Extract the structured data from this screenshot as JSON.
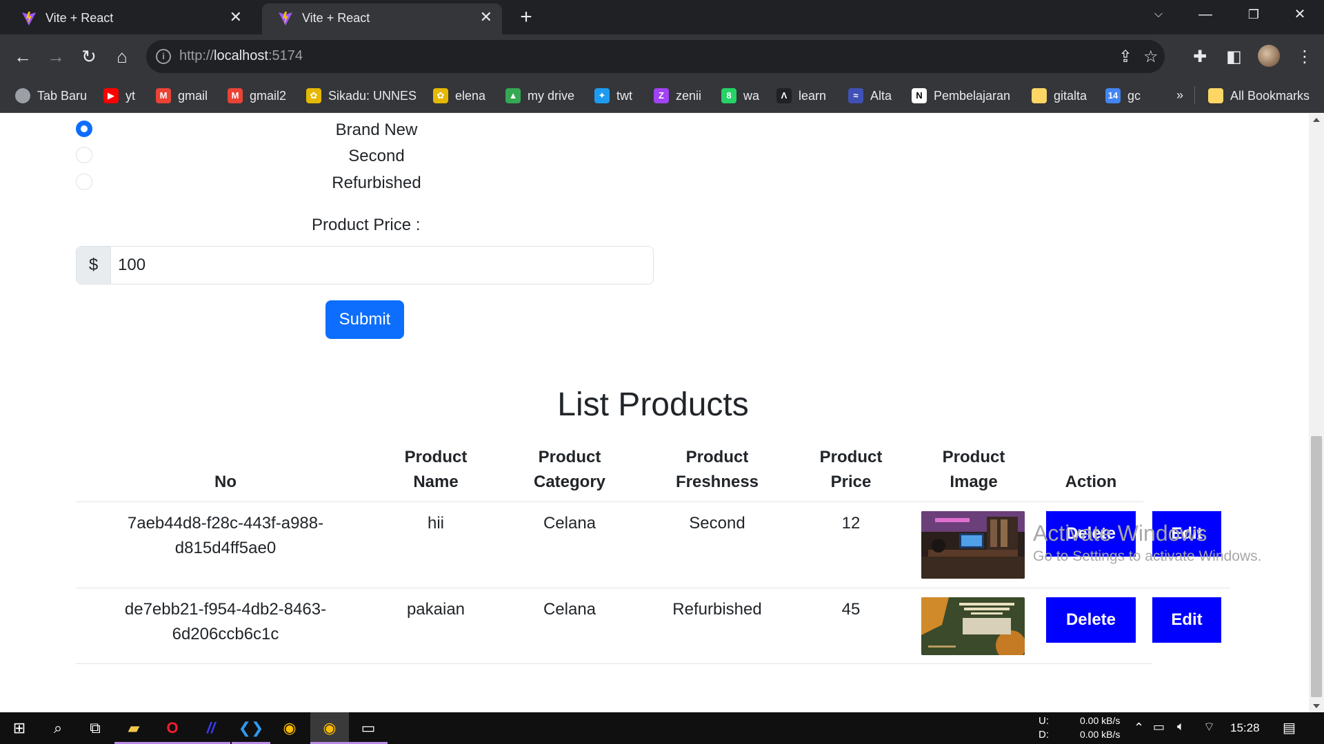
{
  "browser": {
    "tabs": [
      {
        "title": "Vite + React",
        "active": false
      },
      {
        "title": "Vite + React",
        "active": true
      }
    ],
    "address": {
      "scheme": "http://",
      "host": "localhost",
      "port": ":5174"
    },
    "bookmarks": [
      {
        "label": "Tab Baru",
        "icon": "globe-icon",
        "color": "#9aa0a6"
      },
      {
        "label": "yt",
        "icon": "youtube-icon",
        "color": "#ff0000"
      },
      {
        "label": "gmail",
        "icon": "gmail-icon",
        "color": "#ea4335"
      },
      {
        "label": "gmail2",
        "icon": "gmail-icon",
        "color": "#ea4335"
      },
      {
        "label": "Sikadu: UNNES",
        "icon": "unnes-logo-icon",
        "color": "#e6b800"
      },
      {
        "label": "elena",
        "icon": "unnes-logo-icon",
        "color": "#e6b800"
      },
      {
        "label": "my drive",
        "icon": "google-drive-icon",
        "color": "#34a853"
      },
      {
        "label": "twt",
        "icon": "twitter-icon",
        "color": "#1d9bf0"
      },
      {
        "label": "zenii",
        "icon": "zenii-icon",
        "color": "#a142f4"
      },
      {
        "label": "wa",
        "icon": "whatsapp-icon",
        "color": "#25d366"
      },
      {
        "label": "learn",
        "icon": "learn-icon",
        "color": "#202124"
      },
      {
        "label": "Alta",
        "icon": "alta-icon",
        "color": "#3f51b5"
      },
      {
        "label": "Pembelajaran",
        "icon": "notion-icon",
        "color": "#ffffff"
      },
      {
        "label": "gitalta",
        "icon": "folder-icon",
        "color": "#fdd663"
      },
      {
        "label": "gc",
        "icon": "google-calendar-icon",
        "color": "#4285f4"
      }
    ],
    "bookmarks_overflow": "»",
    "all_bookmarks": "All Bookmarks"
  },
  "form": {
    "freshness_options": [
      {
        "label": "Brand New",
        "checked": true
      },
      {
        "label": "Second",
        "checked": false
      },
      {
        "label": "Refurbished",
        "checked": false
      }
    ],
    "price_label": "Product Price :",
    "price_prefix": "$",
    "price_value": "100",
    "submit_label": "Submit"
  },
  "list": {
    "title": "List Products",
    "headers": {
      "no": "No",
      "name": [
        "Product",
        "Name"
      ],
      "category": [
        "Product",
        "Category"
      ],
      "freshness": [
        "Product",
        "Freshness"
      ],
      "price": [
        "Product",
        "Price"
      ],
      "image": [
        "Product",
        "Image"
      ],
      "action": "Action"
    },
    "rows": [
      {
        "no": [
          "7aeb44d8-f28c-443f-a988-",
          "d815d4ff5ae0"
        ],
        "name": "hii",
        "category": "Celana",
        "freshness": "Second",
        "price": "12",
        "image": "room-photo",
        "delete": "Delete",
        "edit": "Edit"
      },
      {
        "no": [
          "de7ebb21-f954-4db2-8463-",
          "6d206ccb6c1c"
        ],
        "name": "pakaian",
        "category": "Celana",
        "freshness": "Refurbished",
        "price": "45",
        "image": "event-banner",
        "delete": "Delete",
        "edit": "Edit"
      }
    ]
  },
  "watermark": {
    "line1": "Activate Windows",
    "line2": "Go to Settings to activate Windows."
  },
  "taskbar": {
    "net_up_label": "U:",
    "net_down_label": "D:",
    "net_up": "0.00 kB/s",
    "net_down": "0.00 kB/s",
    "time": "15:28"
  },
  "colors": {
    "primary": "#0d6efd",
    "action_button": "#0000ff"
  }
}
